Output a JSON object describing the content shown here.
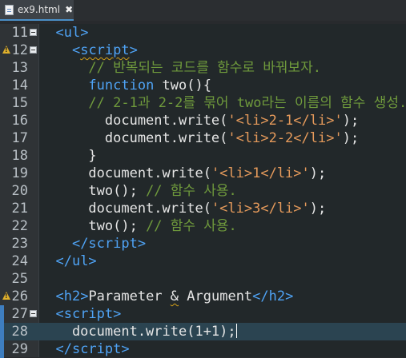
{
  "tab": {
    "title": "ex9.html",
    "close": "✖"
  },
  "lines": [
    {
      "num": "11",
      "html": "<span class=\"plain\">  </span><span class=\"tag\">&lt;ul&gt;</span>"
    },
    {
      "num": "12",
      "html": "<span class=\"plain\">    </span><span class=\"tag\">&lt;<span class=\"squig\">script</span>&gt;</span>"
    },
    {
      "num": "13",
      "html": "<span class=\"cm\">      // 반복되는 코드를 함수로 바꿔보자.</span>"
    },
    {
      "num": "14",
      "html": "<span class=\"plain\">      </span><span class=\"kw\">function</span><span class=\"plain\"> two(){</span>"
    },
    {
      "num": "15",
      "html": "<span class=\"cm\">      // 2-1과 2-2를 묶어 two라는 이름의 함수 생성.</span>"
    },
    {
      "num": "16",
      "html": "<span class=\"plain\">        document.write(</span><span class=\"str\">'&lt;li&gt;2-1&lt;/li&gt;'</span><span class=\"plain\">);</span>"
    },
    {
      "num": "17",
      "html": "<span class=\"plain\">        document.write(</span><span class=\"str\">'&lt;li&gt;2-2&lt;/li&gt;'</span><span class=\"plain\">);</span>"
    },
    {
      "num": "18",
      "html": "<span class=\"plain\">      }</span>"
    },
    {
      "num": "19",
      "html": "<span class=\"plain\">      document.write(</span><span class=\"str\">'&lt;li&gt;1&lt;/li&gt;'</span><span class=\"plain\">);</span>"
    },
    {
      "num": "20",
      "html": "<span class=\"plain\">      two(); </span><span class=\"cm\">// 함수 사용.</span>"
    },
    {
      "num": "21",
      "html": "<span class=\"plain\">      document.write(</span><span class=\"str\">'&lt;li&gt;3&lt;/li&gt;'</span><span class=\"plain\">);</span>"
    },
    {
      "num": "22",
      "html": "<span class=\"plain\">      two(); </span><span class=\"cm\">// 함수 사용.</span>"
    },
    {
      "num": "23",
      "html": "<span class=\"plain\">    </span><span class=\"tag\">&lt;/script&gt;</span>"
    },
    {
      "num": "24",
      "html": "<span class=\"plain\">  </span><span class=\"tag\">&lt;/ul&gt;</span>"
    },
    {
      "num": "25",
      "html": ""
    },
    {
      "num": "26",
      "html": "<span class=\"plain\">  </span><span class=\"tag\">&lt;h2&gt;</span><span class=\"plain\">Parameter <span class=\"squig\">&amp;</span> Argument</span><span class=\"tag\">&lt;/h2&gt;</span>"
    },
    {
      "num": "27",
      "html": "<span class=\"plain\">  </span><span class=\"tag\">&lt;script&gt;</span>"
    },
    {
      "num": "28",
      "html": "<span class=\"plain\">    document.write(1+1);</span><span class=\"cursor\"></span>"
    },
    {
      "num": "29",
      "html": "<span class=\"plain\">  </span><span class=\"tag\">&lt;/script&gt;</span>"
    }
  ],
  "folds": [
    "11",
    "12",
    "27"
  ],
  "warnings": [
    "12",
    "26"
  ],
  "current_line": "28",
  "changed_lines": [
    "27",
    "28",
    "29"
  ]
}
